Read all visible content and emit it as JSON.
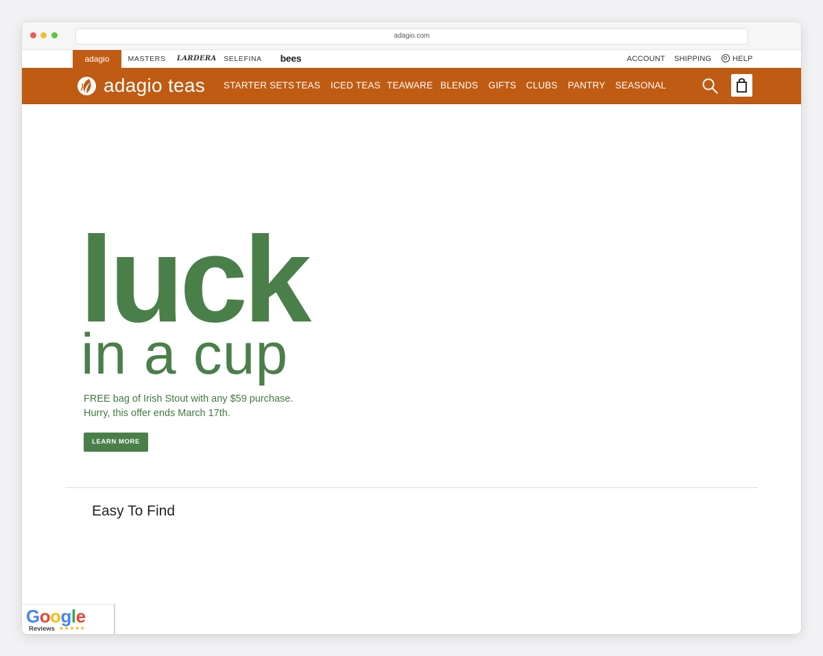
{
  "browser": {
    "url": "adagio.com"
  },
  "brand_bar": {
    "tabs": [
      "adagio",
      "MASTERS",
      "LARDERA",
      "SELEFINA",
      "bees"
    ],
    "active": "adagio",
    "links": {
      "account": "ACCOUNT",
      "shipping": "SHIPPING",
      "help": "HELP"
    }
  },
  "nav": {
    "logo_text": "adagio teas",
    "items": [
      "STARTER SETS",
      "TEAS",
      "ICED TEAS",
      "TEAWARE",
      "BLENDS",
      "GIFTS",
      "CLUBS",
      "PANTRY",
      "SEASONAL"
    ],
    "icons": {
      "search": "search-icon",
      "cart": "shopping-bag-icon"
    }
  },
  "hero": {
    "headline": "luck",
    "subheadline": "in a cup",
    "promo_line_1": "FREE bag of Irish Stout with any $59 purchase.",
    "promo_line_2": "Hurry, this offer ends March 17th.",
    "cta": "LEARN MORE"
  },
  "section": {
    "title": "Easy To Find"
  },
  "badge": {
    "brand": "Google",
    "label": "Reviews",
    "stars": "★★★★★"
  },
  "colors": {
    "brand_orange": "#c05b13",
    "hero_green": "#4a7f4a"
  }
}
